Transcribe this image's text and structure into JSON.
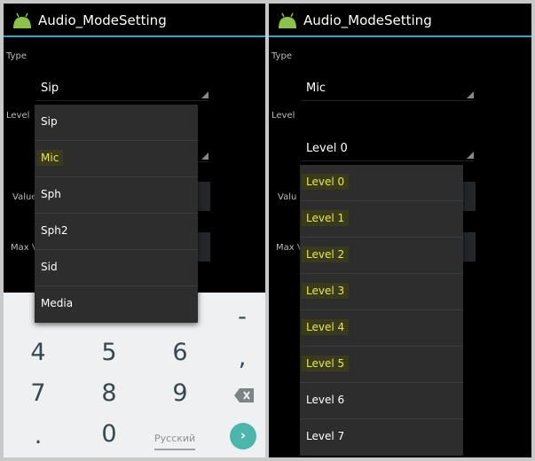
{
  "left": {
    "title": "Audio_ModeSetting",
    "labels": {
      "type": "Type",
      "level": "Level",
      "value": "Value",
      "max": "Max V"
    },
    "type_selected": "Sip",
    "type_options": [
      {
        "label": "Sip",
        "highlighted": false
      },
      {
        "label": "Mic",
        "highlighted": true
      },
      {
        "label": "Sph",
        "highlighted": false
      },
      {
        "label": "Sph2",
        "highlighted": false
      },
      {
        "label": "Sid",
        "highlighted": false
      },
      {
        "label": "Media",
        "highlighted": false
      }
    ],
    "keyboard": {
      "keys": [
        "-",
        "4",
        "5",
        "6",
        ",",
        "7",
        "8",
        "9",
        ".",
        "0"
      ],
      "language": "Русский",
      "backspace": "backspace-icon",
      "go": "arrow-right-icon",
      "go_color": "#4db6ac"
    }
  },
  "right": {
    "title": "Audio_ModeSetting",
    "labels": {
      "type": "Type",
      "level": "Level",
      "value": "Valu",
      "max": "Max V"
    },
    "type_selected": "Mic",
    "level_selected": "Level 0",
    "level_options": [
      {
        "label": "Level 0",
        "highlighted": true
      },
      {
        "label": "Level 1",
        "highlighted": true
      },
      {
        "label": "Level 2",
        "highlighted": true
      },
      {
        "label": "Level 3",
        "highlighted": true
      },
      {
        "label": "Level 4",
        "highlighted": true
      },
      {
        "label": "Level 5",
        "highlighted": true
      },
      {
        "label": "Level 6",
        "highlighted": false
      },
      {
        "label": "Level 7",
        "highlighted": false
      }
    ]
  },
  "colors": {
    "accent": "#33a6d0",
    "highlight": "#e8e84a",
    "android": "#8bc34a"
  }
}
